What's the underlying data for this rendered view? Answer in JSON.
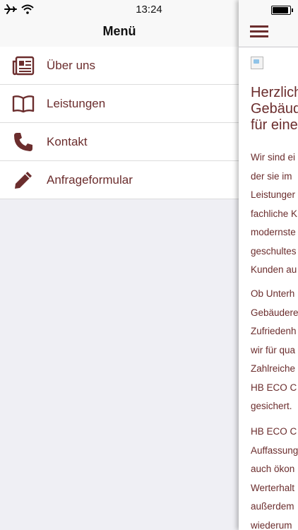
{
  "status_bar": {
    "time": "13:24"
  },
  "drawer": {
    "title": "Menü",
    "items": [
      {
        "label": "Über uns",
        "icon": "newspaper-icon"
      },
      {
        "label": "Leistungen",
        "icon": "book-icon"
      },
      {
        "label": "Kontakt",
        "icon": "phone-icon"
      },
      {
        "label": "Anfrageformular",
        "icon": "pencil-icon"
      }
    ]
  },
  "content": {
    "heading_lines": [
      "Herzlich",
      "Gebäud",
      "für eine"
    ],
    "paragraph1": [
      "Wir sind ei",
      "der sie im",
      "Leistunger",
      "fachliche K",
      "modernste",
      "geschultes",
      "Kunden au"
    ],
    "paragraph2": [
      "Ob Unterh",
      "Gebäudere",
      "Zufriedenh",
      "wir für qua",
      "Zahlreiche",
      "HB ECO C",
      "gesichert."
    ],
    "paragraph3": [
      "HB ECO C",
      "Auffassung",
      "auch ökon",
      "Werterhalt",
      "außerdem",
      "wiederum"
    ]
  },
  "colors": {
    "accent": "#6b2d2d",
    "background": "#efeff4"
  }
}
